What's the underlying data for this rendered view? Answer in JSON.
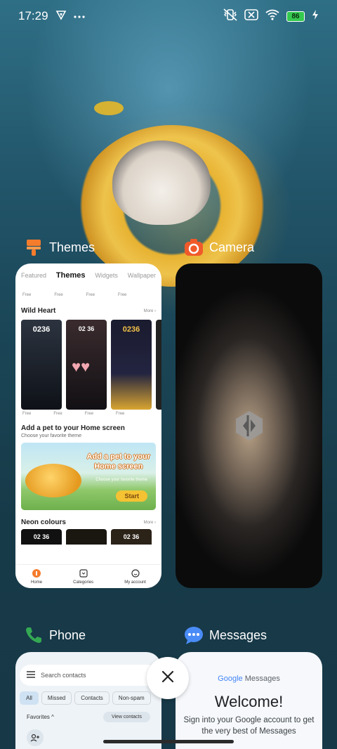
{
  "status_bar": {
    "time": "17:29",
    "battery": "86",
    "icons": [
      "vpn-icon",
      "more-dots-icon",
      "vibrate-icon",
      "no-sim-icon",
      "wifi-icon",
      "charging-icon"
    ]
  },
  "apps": {
    "themes": {
      "name": "Themes",
      "tabs": [
        "Featured",
        "Themes",
        "Widgets",
        "Wallpaper"
      ],
      "active_tab": "Themes",
      "free_label": "Free",
      "section1": {
        "title": "Wild Heart",
        "more": "More"
      },
      "thumbs": [
        {
          "time": "0236",
          "colors": [
            "#2c3440",
            "#0e1117"
          ]
        },
        {
          "time": "02 36",
          "colors": [
            "#3a2b2e",
            "#121014"
          ]
        },
        {
          "time": "0236",
          "colors": [
            "#1a1b2e",
            "#d9a531"
          ]
        }
      ],
      "section2": {
        "title": "Add a pet to your Home screen",
        "subtitle": "Choose your favorite theme"
      },
      "banner": {
        "title_line1": "Add a pet to your",
        "title_line2": "Home screen",
        "subtitle": "Choose your favorite theme",
        "button": "Start"
      },
      "section3": {
        "title": "Neon colours",
        "more": "More"
      },
      "neon_thumbs": [
        "02 36",
        "",
        "02 36"
      ],
      "nav": [
        {
          "label": "Home",
          "icon": "home-icon"
        },
        {
          "label": "Categories",
          "icon": "categories-icon"
        },
        {
          "label": "My account",
          "icon": "account-icon"
        }
      ]
    },
    "camera": {
      "name": "Camera"
    },
    "phone": {
      "name": "Phone",
      "search_placeholder": "Search contacts",
      "chips": [
        "All",
        "Missed",
        "Contacts",
        "Non-spam"
      ],
      "favorites": "Favorites",
      "view_contacts": "View contacts"
    },
    "messages": {
      "name": "Messages",
      "logo_google": "Google",
      "logo_messages": "Messages",
      "welcome": "Welcome!",
      "subtitle": "Sign into your Google account to get the very best of Messages"
    }
  },
  "colors": {
    "themes_accent": "#f47c2c",
    "camera_icon": "#f05a2b",
    "phone_icon": "#34a853",
    "messages_icon": "#4a8cf7"
  }
}
